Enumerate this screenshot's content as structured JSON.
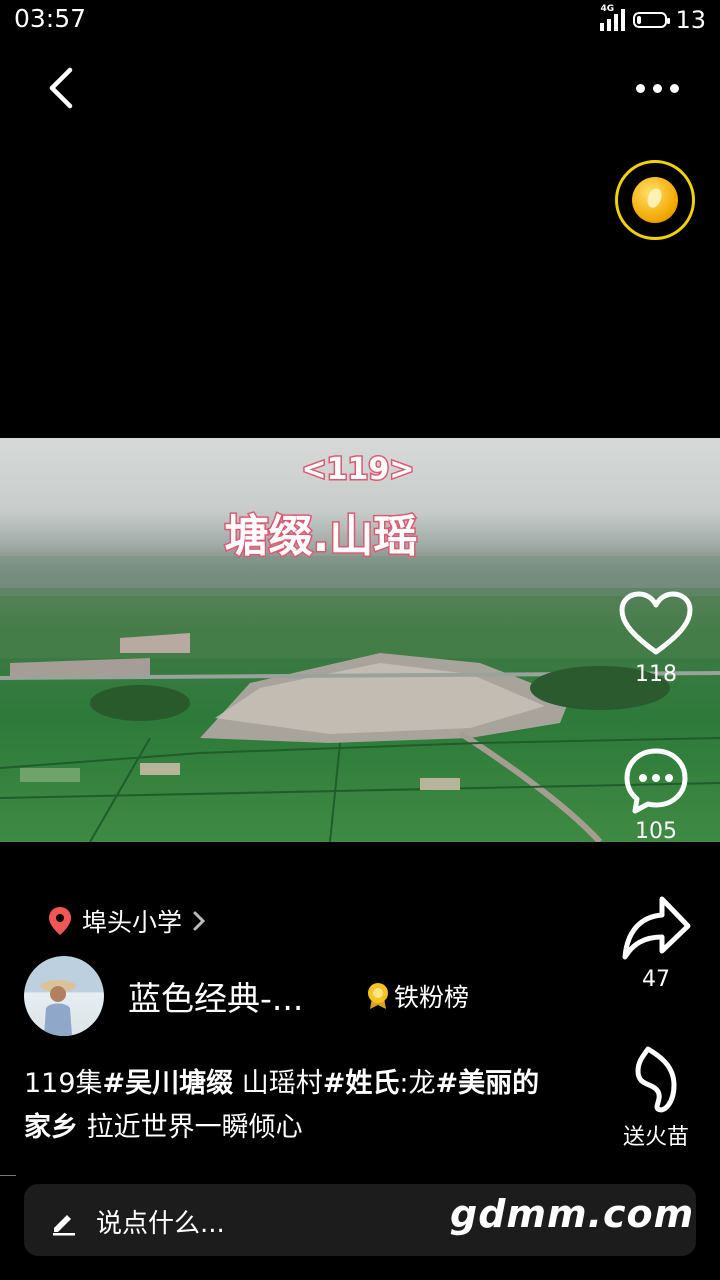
{
  "status_bar": {
    "time": "03:57",
    "network": "4G",
    "battery_level": "13"
  },
  "video": {
    "overlay_episode": "<119>",
    "overlay_title": "塘缀.山瑶"
  },
  "actions": {
    "like_count": "118",
    "comment_count": "105",
    "share_count": "47",
    "send_fire_label": "送火苗"
  },
  "location": {
    "label": "埠头小学"
  },
  "author": {
    "name": "蓝色经典-...",
    "fan_rank_label": "铁粉榜"
  },
  "description": {
    "p1": "119集",
    "t1": "#吴川塘缀",
    "p2": " 山瑶村",
    "t2": "#姓氏",
    "p3": ":龙",
    "t3": "#美丽的家乡",
    "p4": " 拉近世界一瞬倾心"
  },
  "comment_bar": {
    "placeholder": "说点什么..."
  },
  "watermark": "gdmm.com",
  "colors": {
    "coin_ring": "#f2d200",
    "location_pin": "#f05656",
    "caption_outline": "#e0586f"
  }
}
